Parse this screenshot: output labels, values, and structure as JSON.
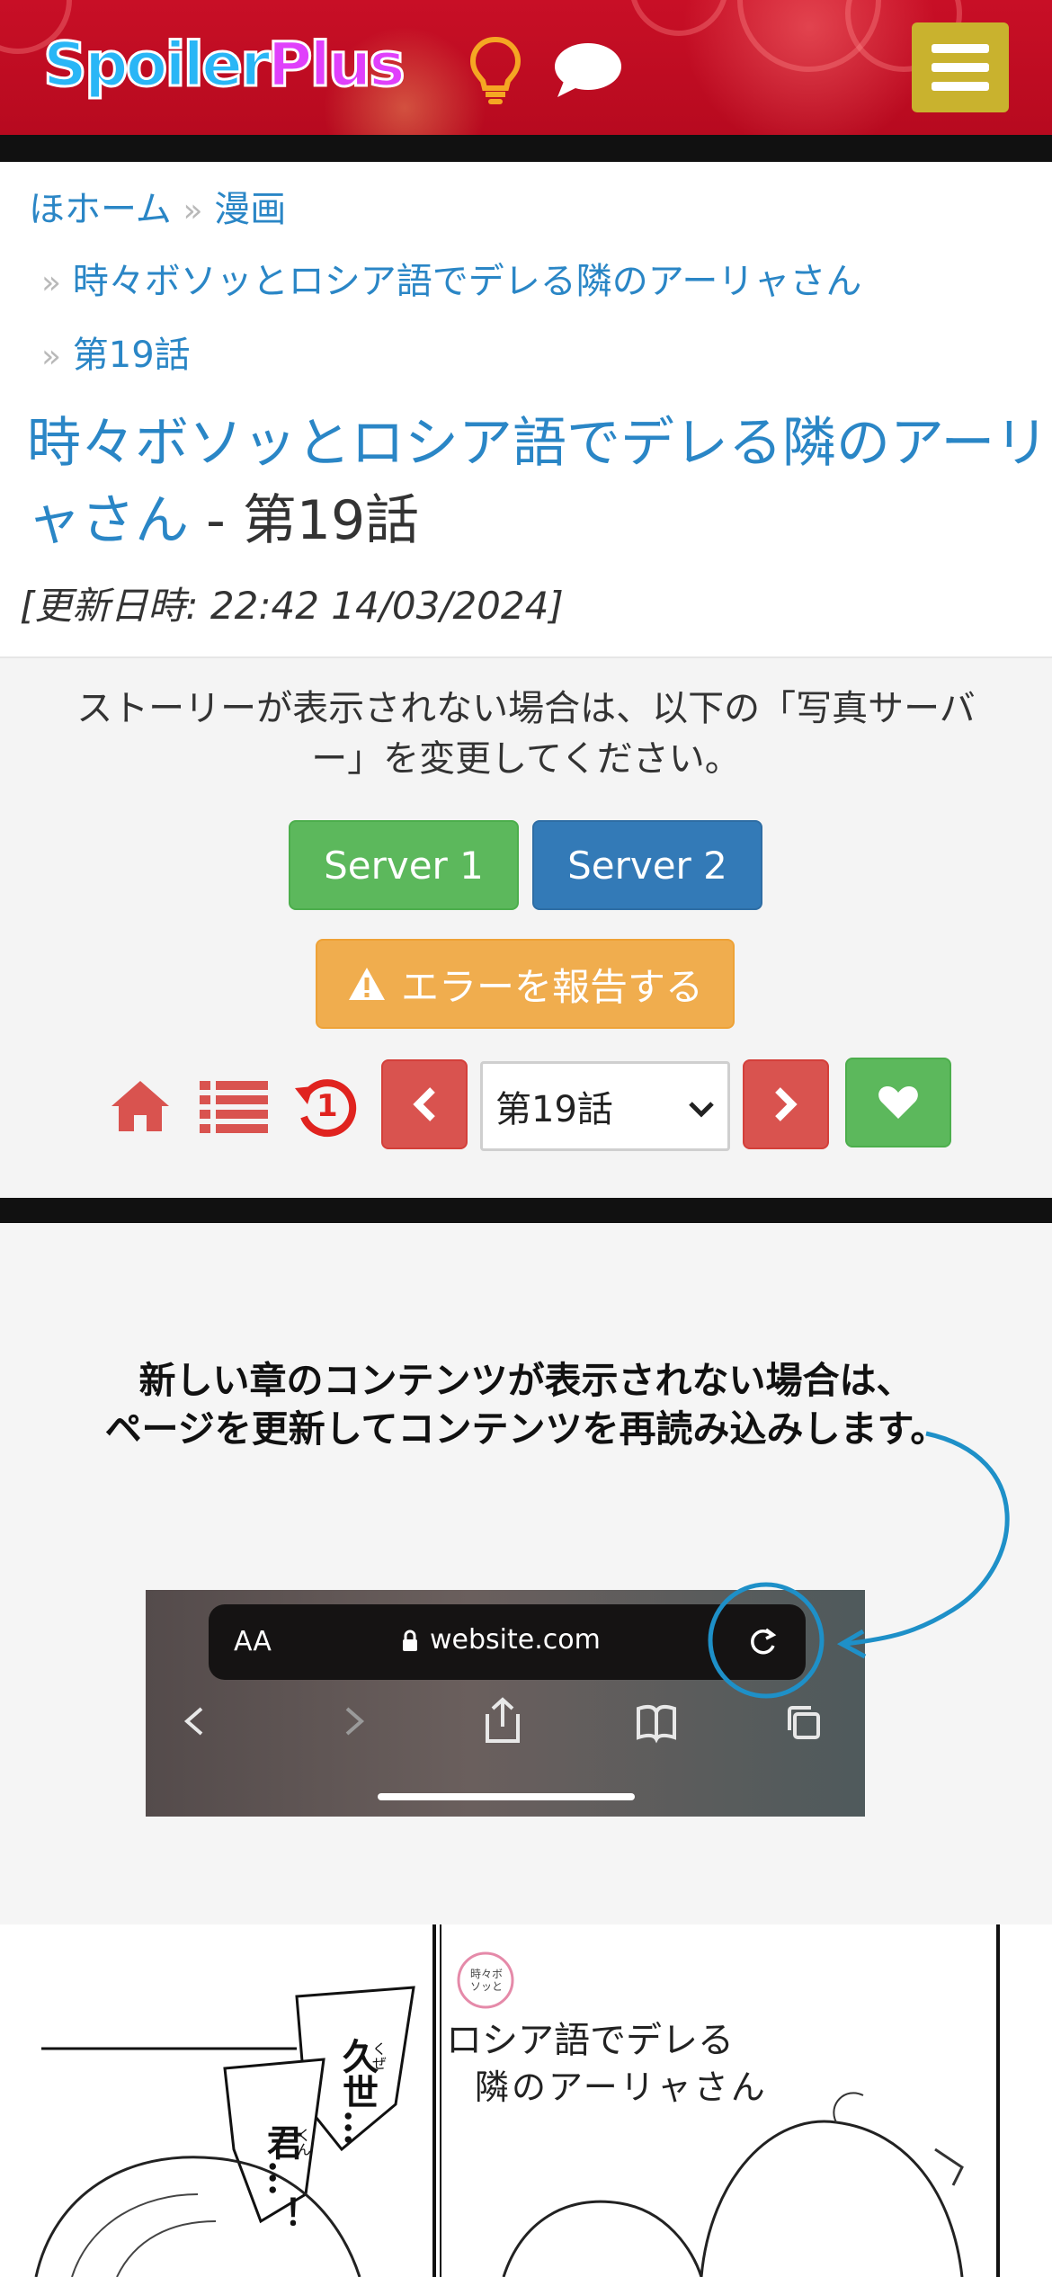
{
  "header": {
    "logo_part1": "Spoiler",
    "logo_part2": "Plus",
    "icons": [
      "lightbulb-icon",
      "chat-icon",
      "hamburger-menu-icon"
    ],
    "brand_color": "#c80f26"
  },
  "breadcrumb": {
    "home": "ほホーム",
    "separator": "»",
    "category": "漫画",
    "series": "時々ボソッとロシア語でデレる隣のアーリャさん",
    "chapter": "第19話"
  },
  "title": {
    "series_line1": "時々ボソッとロシア語でデレる隣のアーリ",
    "series_line2": "ャさん",
    "suffix": " - 第19話"
  },
  "updated": "[更新日時: 22:42 14/03/2024]",
  "server_notice": {
    "line1": "ストーリーが表示されない場合は、以下の「写真サーバ",
    "line2": "ー」を変更してください。"
  },
  "buttons": {
    "server1": "Server 1",
    "server2": "Server 2",
    "report": "エラーを報告する"
  },
  "nav": {
    "chapter_select": "第19話",
    "history_badge": "1",
    "icons": [
      "home-icon",
      "list-icon",
      "history-icon",
      "chevron-left-icon",
      "chevron-right-icon",
      "heart-icon"
    ]
  },
  "reload_notice": {
    "line1": "新しい章のコンテンツが表示されない場合は、",
    "line2": "ページを更新してコンテンツを再読み込みします。",
    "aa_label": "AA",
    "url": "website.com",
    "highlight_color": "#1e90c8"
  },
  "manga": {
    "speech1": "久世…",
    "speech2": "君…！",
    "ruby1": "くぜ",
    "ruby2": "くん",
    "logo_line1": "ロシア語でデレる",
    "logo_line2": "隣のアーリャさん",
    "logo_badge": "時々ボソッと"
  }
}
